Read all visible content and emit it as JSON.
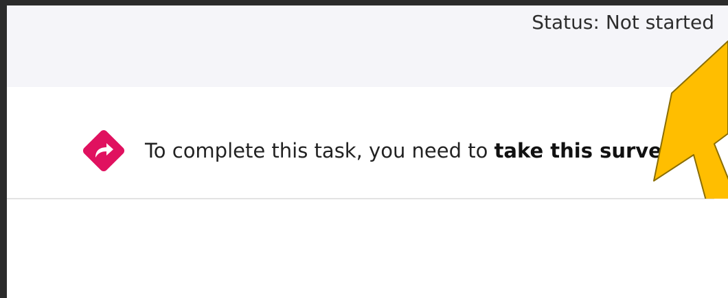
{
  "status": {
    "text": "Status: Not started"
  },
  "task": {
    "prefix": "To complete this task, you need to ",
    "link_label": "take this survey"
  },
  "icon": {
    "name": "survey-redirect-icon",
    "color": "#e0115f"
  },
  "annotation": {
    "arrow_color": "#ffbe00",
    "arrow_outline": "#8a6d00"
  },
  "colors": {
    "status_bar_bg": "#f5f5f9",
    "frame_bg": "#2b2b2b",
    "divider": "#e2e2e2"
  }
}
